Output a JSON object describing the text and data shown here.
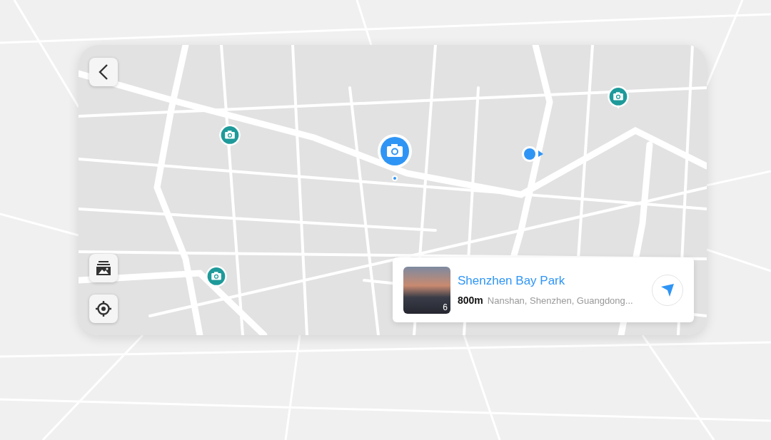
{
  "map_pins": [
    {
      "selected": false
    },
    {
      "selected": true
    },
    {
      "selected": false
    },
    {
      "selected": false
    }
  ],
  "place_card": {
    "title": "Shenzhen Bay Park",
    "distance": "800m",
    "address": "Nanshan, Shenzhen, Guangdong...",
    "photo_count": "6"
  }
}
